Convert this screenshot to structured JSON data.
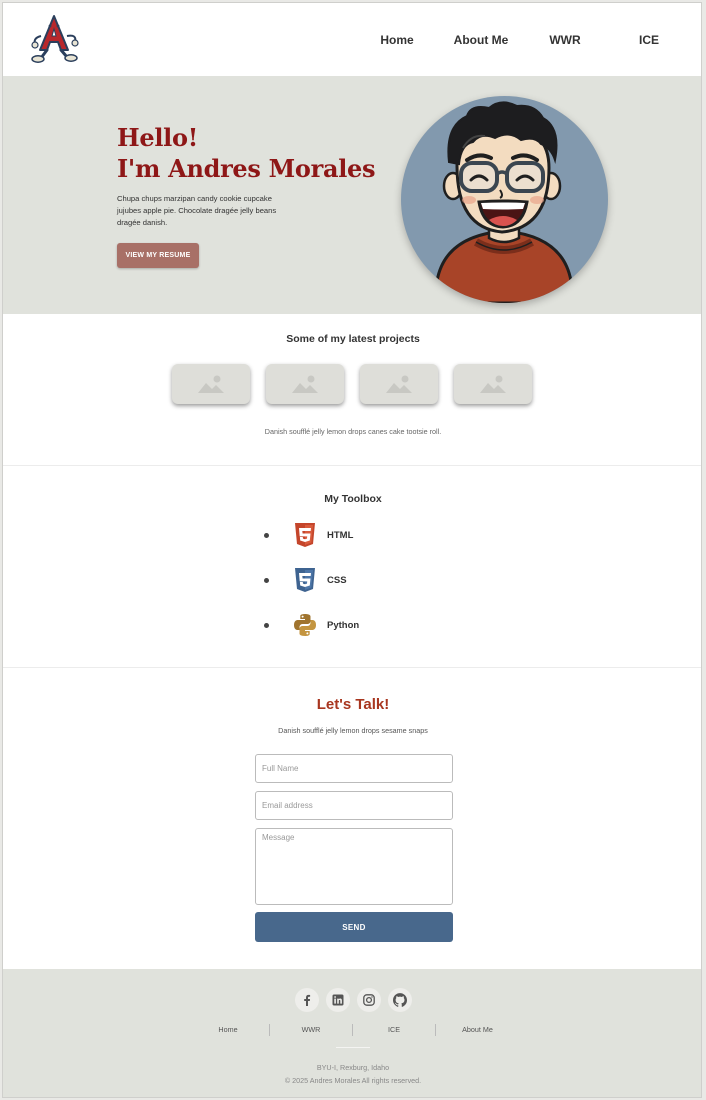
{
  "header": {
    "nav": [
      {
        "label": "Home"
      },
      {
        "label": "About Me"
      },
      {
        "label": "WWR"
      },
      {
        "label": "ICE"
      }
    ]
  },
  "hero": {
    "greeting": "Hello!",
    "name_line": "I'm Andres Morales",
    "text": "Chupa chups marzipan candy cookie cupcake jujubes apple pie. Chocolate dragée jelly beans dragée danish.",
    "resume_button": "VIEW MY RESUME"
  },
  "projects": {
    "title": "Some of my latest projects",
    "cards": [
      "image-placeholder-icon",
      "image-placeholder-icon",
      "image-placeholder-icon",
      "image-placeholder-icon"
    ],
    "caption": "Danish soufflé jelly lemon drops canes cake tootsie roll."
  },
  "toolbox": {
    "title": "My Toolbox",
    "items": [
      {
        "label": "HTML",
        "icon": "html5-icon"
      },
      {
        "label": "CSS",
        "icon": "css3-icon"
      },
      {
        "label": "Python",
        "icon": "python-icon"
      }
    ]
  },
  "contact": {
    "title": "Let's Talk!",
    "subtitle": "Danish soufflé jelly lemon drops sesame snaps",
    "fullname_placeholder": "Full Name",
    "email_placeholder": "Email address",
    "message_placeholder": "Message",
    "send_label": "SEND"
  },
  "footer": {
    "socials": [
      "facebook-icon",
      "linkedin-icon",
      "instagram-icon",
      "github-icon"
    ],
    "nav": [
      {
        "label": "Home"
      },
      {
        "label": "WWR"
      },
      {
        "label": "ICE"
      },
      {
        "label": "About Me"
      }
    ],
    "location": "BYU-I, Rexburg, Idaho",
    "copyright": "© 2025 Andres Morales  All rights reserved."
  },
  "colors": {
    "accent_red": "#8e1717",
    "resume_button": "#a87067",
    "send_button": "#48688c",
    "hero_bg": "#e0e2dc",
    "avatar_bg": "#8299ae",
    "talk_title": "#a8361f"
  }
}
